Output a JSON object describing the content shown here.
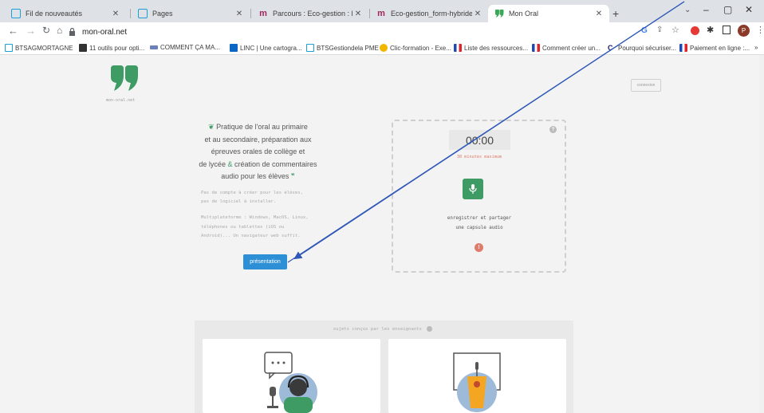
{
  "browser": {
    "tabs": [
      {
        "title": "Fil de nouveautés",
        "fav_color": "#1a9fd6"
      },
      {
        "title": "Pages",
        "fav_color": "#1a9fd6"
      },
      {
        "title": "Parcours : Eco-gestion : Favorise",
        "fav_color": "#a0285f"
      },
      {
        "title": "Eco-gestion_form-hybrides: Dép",
        "fav_color": "#a0285f"
      },
      {
        "title": "Mon Oral",
        "fav_color": "#3aa857"
      }
    ],
    "url": "mon-oral.net",
    "profile_initial": "P",
    "bookmarks": [
      "BTSAGMORTAGNE",
      "11 outils pour opti...",
      "COMMENT ÇA MA...",
      "LINC | Une cartogra...",
      "BTSGestiondela PME",
      "Clic-formation - Exe...",
      "Liste des ressources...",
      "Comment créer un...",
      "Pourquoi sécuriser...",
      "Paiement en ligne :..."
    ],
    "more_bookmarks": "»"
  },
  "site": {
    "logo_caption": "mon-oral.net",
    "connect_label": "connexion",
    "intro_line1": "Pratique de l'oral au primaire",
    "intro_line2": "et au secondaire, préparation aux",
    "intro_line3": "épreuves orales de collège et",
    "intro_line4a": "de lycée",
    "intro_line4b": "&",
    "intro_line4c": "création de commentaires",
    "intro_line5": "audio pour les élèves",
    "no_account_line1": "Pas de compte à créer pour les élèves,",
    "no_account_line2": "pas de logiciel à installer.",
    "multi_line1": "Multiplateforme : Windows, MacOS, Linux,",
    "multi_line2": "téléphones  ou  tablettes  (iOS  ou",
    "multi_line3": "Android)... Un navigateur web suffit.",
    "presentation_button": "présentation",
    "timer": "00:00",
    "timer_limit": "30 minutes maximum",
    "record_text_line1": "enregistrer et partager",
    "record_text_line2": "une capsule audio",
    "help_mark": "?",
    "alert_mark": "!",
    "subjects_title": "sujets conçus par les enseignants"
  },
  "colors": {
    "accent_green": "#3d9b63",
    "button_blue": "#2d8fd5",
    "timer_red": "#e07a6a",
    "arrow_blue": "#2f57b8"
  }
}
